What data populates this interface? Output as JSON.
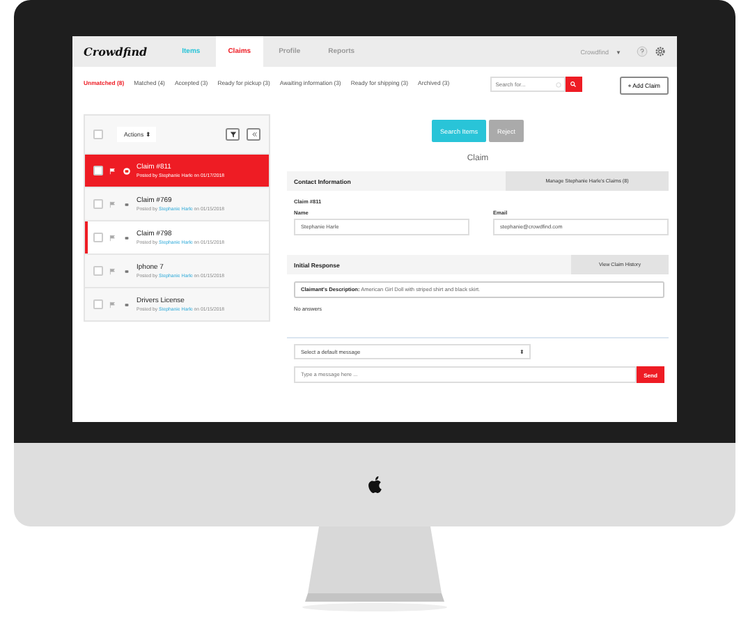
{
  "nav": {
    "logo": "Crowdfind",
    "tabs": [
      {
        "label": "Items",
        "selected": false,
        "color": "#29c4d8"
      },
      {
        "label": "Claims",
        "selected": true,
        "color": "#ee1c24"
      },
      {
        "label": "Profile",
        "selected": false,
        "color": "#9a9a9a"
      },
      {
        "label": "Reports",
        "selected": false,
        "color": "#9a9a9a"
      }
    ],
    "account": "Crowdfind",
    "account_caret": "▼"
  },
  "filters": [
    {
      "label": "Unmatched (8)",
      "selected": true
    },
    {
      "label": "Matched (4)",
      "selected": false
    },
    {
      "label": "Accepted (3)",
      "selected": false
    },
    {
      "label": "Ready for pickup (3)",
      "selected": false
    },
    {
      "label": "Awaiting information (3)",
      "selected": false
    },
    {
      "label": "Ready for shipping (3)",
      "selected": false
    },
    {
      "label": "Archived (3)",
      "selected": false
    }
  ],
  "search": {
    "placeholder": "Search for..."
  },
  "add_button": "+ Add Claim",
  "list": {
    "all_checked": false,
    "actions": "Actions",
    "actions_caret": "⬍",
    "rows": [
      {
        "title": "Claim #811",
        "prefix": "Posted by",
        "poster": "Stephanie Harle",
        "suffix": "on 01/17/2018",
        "checked": false,
        "selected": true,
        "highlighted": false
      },
      {
        "title": "Claim #769",
        "prefix": "Posted by",
        "poster": "Stephanie Harle",
        "suffix": "on 01/15/2018",
        "checked": false,
        "selected": false,
        "highlighted": false
      },
      {
        "title": "Claim #798",
        "prefix": "Posted by",
        "poster": "Stephanie Harle",
        "suffix": "on 01/15/2018",
        "checked": false,
        "selected": false,
        "highlighted": true
      },
      {
        "title": "Iphone 7",
        "prefix": "Posted by",
        "poster": "Stephanie Harle",
        "suffix": "on 01/15/2018",
        "checked": false,
        "selected": false,
        "highlighted": false
      },
      {
        "title": "Drivers License",
        "prefix": "Posted by",
        "poster": "Stephanie Harle",
        "suffix": "on 01/15/2018",
        "checked": false,
        "selected": false,
        "highlighted": false
      }
    ]
  },
  "detail": {
    "buttons": [
      "Search Items",
      "Reject"
    ],
    "title": "Claim",
    "contact": {
      "heading": "Contact Information",
      "manage": "Manage Stephanie Harle's Claims (8)",
      "claim_no": "Claim #811",
      "name_label": "Name",
      "name": "Stephanie Harle",
      "email_label": "Email",
      "email": "stephanie@crowdfind.com"
    },
    "response": {
      "heading": "Initial Response",
      "history": "View Claim History",
      "description": "**Claimant's Description:** American Girl Doll with striped shirt and black skirt.",
      "answers": "No answers"
    },
    "message": {
      "select": "Select a default message",
      "select_caret": "⬍",
      "placeholder": "Type a message here ...",
      "send": "Send"
    }
  }
}
